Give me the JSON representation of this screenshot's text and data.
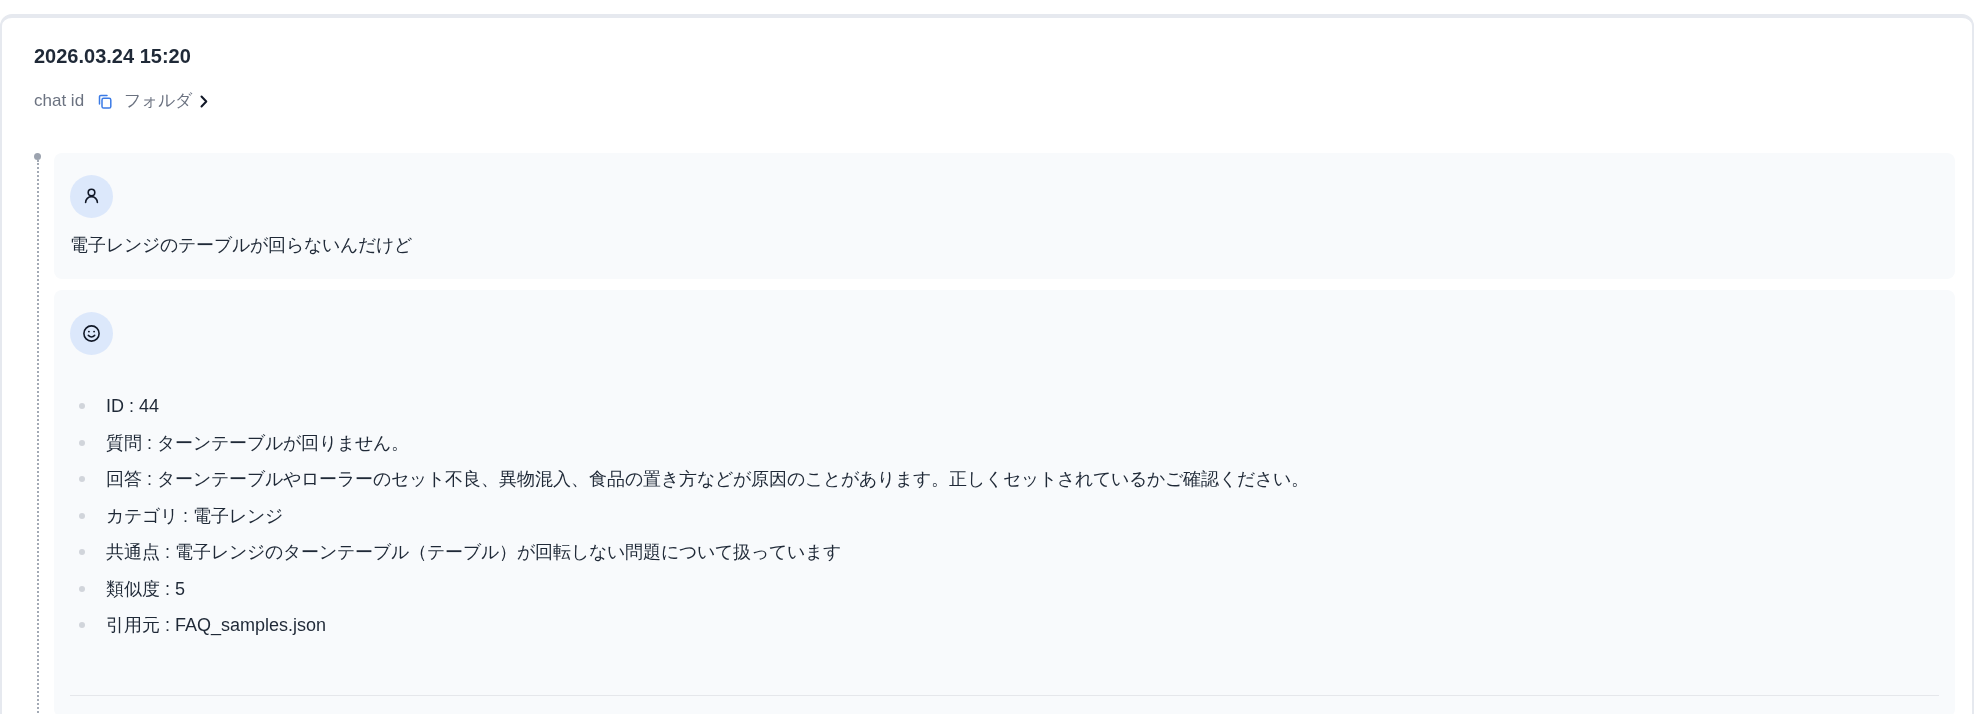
{
  "header": {
    "title": "2026.03.24 15:20",
    "chat_id_label": "chat id",
    "folder_link": "フォルダ"
  },
  "messages": [
    {
      "kind": "user",
      "text": "電子レンジのテーブルが回らないんだけど"
    },
    {
      "kind": "assistant",
      "items": [
        "ID : 44",
        "質問 : ターンテーブルが回りません。",
        "回答 : ターンテーブルやローラーのセット不良、異物混入、食品の置き方などが原因のことがあります。正しくセットされているかご確認ください。",
        "カテゴリ : 電子レンジ",
        "共通点 : 電子レンジのターンテーブル（テーブル）が回転しない問題について扱っています",
        "類似度 : 5",
        "引用元 : FAQ_samples.json"
      ]
    }
  ]
}
